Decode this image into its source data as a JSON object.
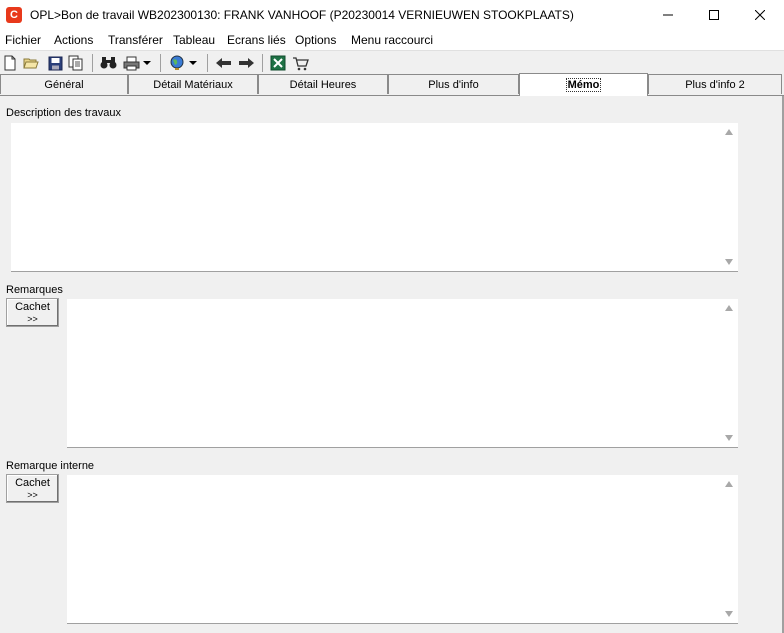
{
  "window": {
    "title": "OPL>Bon de travail WB202300130: FRANK VANHOOF (P20230014 VERNIEUWEN STOOKPLAATS)",
    "logo_letter": "C",
    "minimize_icon": "minimize-icon",
    "maximize_icon": "maximize-icon",
    "close_icon": "close-icon"
  },
  "menu": {
    "items": [
      "Fichier",
      "Actions",
      "Transférer",
      "Tableau",
      "Ecrans liés",
      "Options",
      "Menu raccourci"
    ]
  },
  "toolbar": {
    "icons": [
      "new-document-icon",
      "open-folder-icon",
      "save-icon",
      "copy-icon",
      "binoculars-icon",
      "print-icon",
      "dropdown-arrow-icon",
      "globe-icon",
      "dropdown-arrow-icon",
      "back-arrow-icon",
      "forward-arrow-icon",
      "excel-icon",
      "shopping-cart-icon"
    ]
  },
  "tabs": {
    "items": [
      "Général",
      "Détail Matériaux",
      "Détail Heures",
      "Plus d'info",
      "Mémo",
      "Plus d'info 2"
    ],
    "active": "Mémo"
  },
  "memo": {
    "description_label": "Description des travaux",
    "description_value": "",
    "remarques_label": "Remarques",
    "remarques_value": "",
    "remarque_interne_label": "Remarque interne",
    "remarque_interne_value": "",
    "cachet_label": "Cachet",
    "cachet_sub": ">>"
  },
  "colors": {
    "logo": "#e8391b",
    "window_bg": "#f0f0f0",
    "field_bg": "#ffffff",
    "excel_green": "#1e7145"
  }
}
